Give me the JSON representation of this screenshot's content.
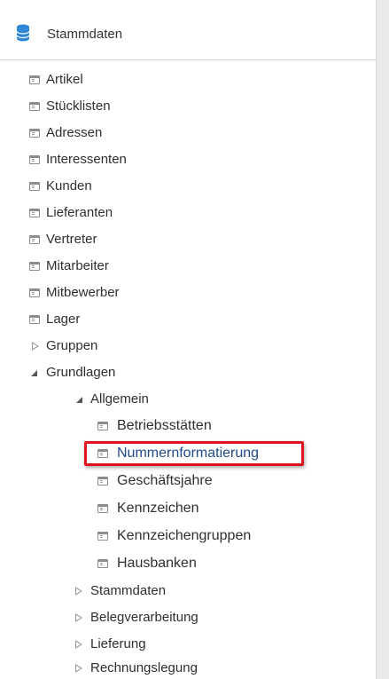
{
  "header": {
    "title": "Stammdaten",
    "icon": "database-icon",
    "icon_color": "#2b86d6"
  },
  "tree": {
    "artikel": "Artikel",
    "stuecklisten": "Stücklisten",
    "adressen": "Adressen",
    "interessenten": "Interessenten",
    "kunden": "Kunden",
    "lieferanten": "Lieferanten",
    "vertreter": "Vertreter",
    "mitarbeiter": "Mitarbeiter",
    "mitbewerber": "Mitbewerber",
    "lager": "Lager",
    "gruppen": "Gruppen",
    "grundlagen": "Grundlagen",
    "allgemein": "Allgemein",
    "betriebsstaetten": "Betriebsstätten",
    "nummernformatierung": "Nummernformatierung",
    "geschaeftsjahre": "Geschäftsjahre",
    "kennzeichen": "Kennzeichen",
    "kennzeichengruppen": "Kennzeichengruppen",
    "hausbanken": "Hausbanken",
    "sub_stammdaten": "Stammdaten",
    "belegverarbeitung": "Belegverarbeitung",
    "lieferung": "Lieferung",
    "rechnungslegung": "Rechnungslegung"
  },
  "highlight_color": "#e0141e"
}
